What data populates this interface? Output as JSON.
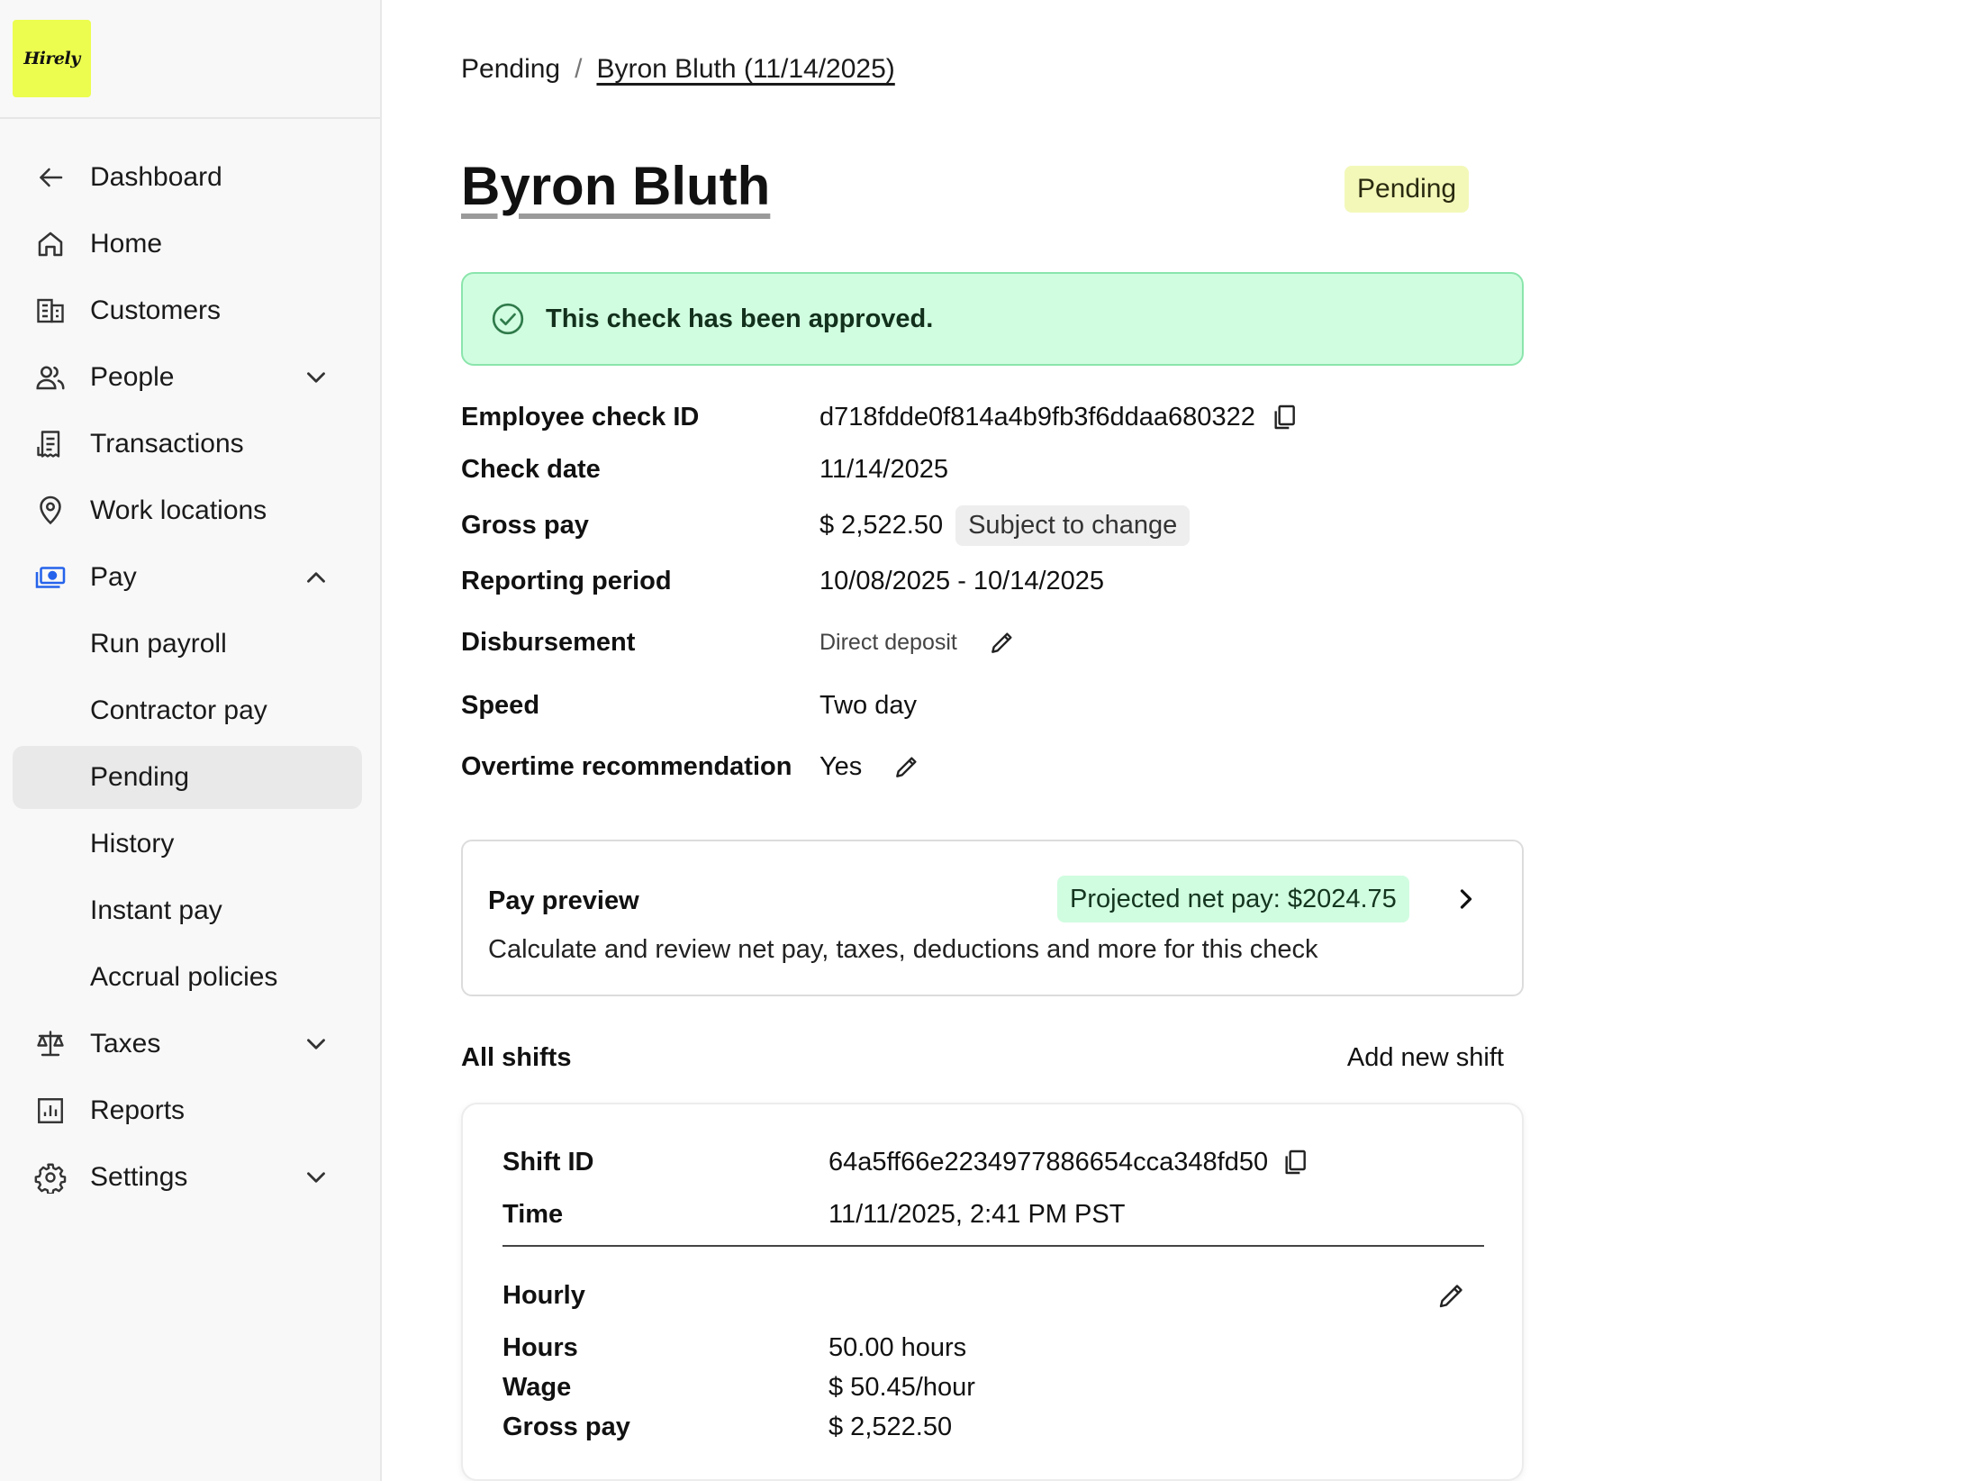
{
  "brand": {
    "logo_text": "Hirely",
    "logo_color": "#ecfd4f"
  },
  "sidebar": {
    "items": [
      {
        "label": "Dashboard",
        "icon": "arrow-left-icon"
      },
      {
        "label": "Home",
        "icon": "home-icon"
      },
      {
        "label": "Customers",
        "icon": "building-icon"
      },
      {
        "label": "People",
        "icon": "users-icon",
        "expandable": true,
        "expanded": false
      },
      {
        "label": "Transactions",
        "icon": "receipt-icon"
      },
      {
        "label": "Work locations",
        "icon": "map-pin-icon"
      },
      {
        "label": "Pay",
        "icon": "cash-icon",
        "expandable": true,
        "expanded": true
      },
      {
        "label": "Run payroll"
      },
      {
        "label": "Contractor pay"
      },
      {
        "label": "Pending",
        "active": true
      },
      {
        "label": "History"
      },
      {
        "label": "Instant pay"
      },
      {
        "label": "Accrual policies"
      },
      {
        "label": "Taxes",
        "icon": "scale-icon",
        "expandable": true,
        "expanded": false
      },
      {
        "label": "Reports",
        "icon": "chart-icon"
      },
      {
        "label": "Settings",
        "icon": "gear-icon",
        "expandable": true,
        "expanded": false
      }
    ]
  },
  "breadcrumb": {
    "parent": "Pending",
    "separator": "/",
    "current": "Byron Bluth (11/14/2025)"
  },
  "page": {
    "title": "Byron Bluth",
    "status": "Pending",
    "status_color": "#f3f8b9"
  },
  "alert": {
    "text": "This check has been approved.",
    "color": "#d0fde0"
  },
  "details": {
    "employee_check_id_label": "Employee check ID",
    "employee_check_id": "d718fdde0f814a4b9fb3f6ddaa680322",
    "check_date_label": "Check date",
    "check_date": "11/14/2025",
    "gross_pay_label": "Gross pay",
    "gross_pay": "$ 2,522.50",
    "gross_pay_tag": "Subject to change",
    "reporting_period_label": "Reporting period",
    "reporting_period": "10/08/2025 - 10/14/2025",
    "disbursement_label": "Disbursement",
    "disbursement": "Direct deposit",
    "speed_label": "Speed",
    "speed": "Two day",
    "overtime_label": "Overtime recommendation",
    "overtime": "Yes"
  },
  "pay_preview": {
    "title": "Pay preview",
    "net_pay": "Projected net pay: $2024.75",
    "description": "Calculate and review net pay, taxes, deductions and more for this check"
  },
  "shifts": {
    "title": "All shifts",
    "add_label": "Add new shift",
    "shift_id_label": "Shift ID",
    "shift_id": "64a5ff66e2234977886654cca348fd50",
    "time_label": "Time",
    "time": "11/11/2025, 2:41 PM PST",
    "type": "Hourly",
    "hours_label": "Hours",
    "hours": "50.00 hours",
    "wage_label": "Wage",
    "wage": "$ 50.45/hour",
    "gross_pay_label": "Gross pay",
    "gross_pay": "$ 2,522.50"
  }
}
